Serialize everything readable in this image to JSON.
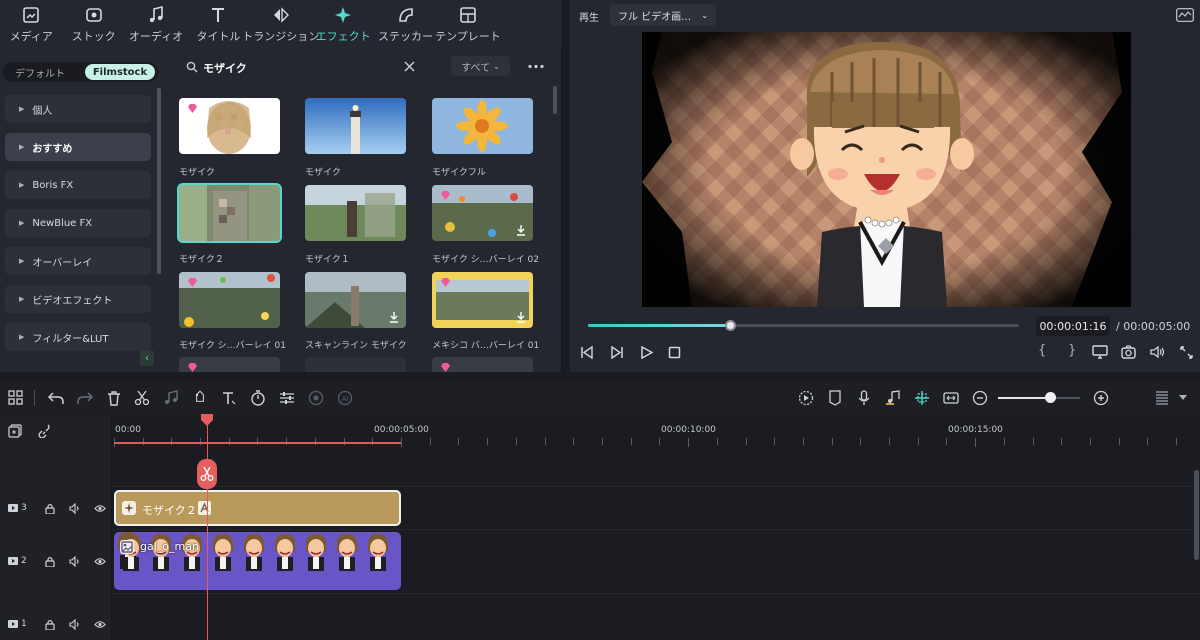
{
  "top_tabs": [
    {
      "label": "メディア",
      "icon": "media-icon"
    },
    {
      "label": "ストック",
      "icon": "stock-icon"
    },
    {
      "label": "オーディオ",
      "icon": "music-note-icon"
    },
    {
      "label": "タイトル",
      "icon": "title-t-icon"
    },
    {
      "label": "トランジション",
      "icon": "transition-icon"
    },
    {
      "label": "エフェクト",
      "icon": "effect-sparkle-icon",
      "active": true
    },
    {
      "label": "ステッカー",
      "icon": "sticker-icon"
    },
    {
      "label": "テンプレート",
      "icon": "template-icon"
    }
  ],
  "sidebar": {
    "segments": [
      "デフォルト",
      "Filmstock"
    ],
    "active_segment": "Filmstock",
    "items": [
      "個人",
      "おすすめ",
      "Boris FX",
      "NewBlue FX",
      "オーバーレイ",
      "ビデオエフェクト",
      "フィルター&LUT"
    ],
    "active_item": "おすすめ"
  },
  "search": {
    "value": "モザイク",
    "filter": "すべて"
  },
  "grid": {
    "items": [
      {
        "label": "モザイク"
      },
      {
        "label": "モザイク"
      },
      {
        "label": "モザイクフル"
      },
      {
        "label": "モザイク２",
        "selected": true
      },
      {
        "label": "モザイク１"
      },
      {
        "label": "モザイク シ…バーレイ 02"
      },
      {
        "label": "モザイク シ…バーレイ 01"
      },
      {
        "label": "スキャンライン モザイク"
      },
      {
        "label": "メキシコ バ…バーレイ 01"
      }
    ]
  },
  "preview": {
    "mode_label": "再生",
    "quality": "フル ビデオ画…",
    "current_time": "00:00:01:16",
    "total_time": "/ 00:00:05:00",
    "progress": 0.33,
    "bracket_in": "{",
    "bracket_out": "}"
  },
  "timeline": {
    "ruler_labels": [
      "00:00",
      "00:00:05:00",
      "00:00:10:00",
      "00:00:15:00"
    ],
    "tracks": [
      {
        "id": "3"
      },
      {
        "id": "2"
      },
      {
        "id": "1"
      }
    ],
    "effect_clip": {
      "label": "モザイク２"
    },
    "video_clip": {
      "label": "gal_o_man"
    }
  },
  "colors": {
    "accent": "#55d9c8",
    "effect_clip": "#b99a5b",
    "video_clip": "#6a55c6",
    "playhead": "#e65b5b"
  }
}
